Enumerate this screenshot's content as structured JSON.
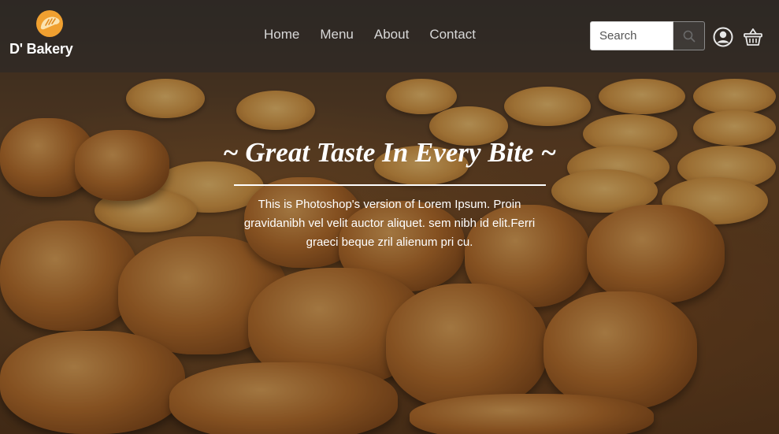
{
  "brand": {
    "name": "D' Bakery",
    "logo_icon": "bread-logo-icon"
  },
  "nav": {
    "items": [
      {
        "label": "Home"
      },
      {
        "label": "Menu"
      },
      {
        "label": "About"
      },
      {
        "label": "Contact"
      }
    ]
  },
  "search": {
    "placeholder": "Search",
    "value": "",
    "button_icon": "search-icon"
  },
  "header_icons": {
    "account_icon": "user-circle-icon",
    "cart_icon": "shopping-basket-icon"
  },
  "hero": {
    "title": "~ Great Taste In Every Bite ~",
    "description": "This is Photoshop's version of Lorem Ipsum. Proin gravidanibh vel velit auctor aliquet. sem nibh id elit.Ferri graeci beque zril alienum pri cu.",
    "background": "pastry-tray-photo"
  },
  "colors": {
    "logo_accent": "#f0a030",
    "nav_text": "#d8d8d8",
    "hero_text": "#ffffff"
  }
}
